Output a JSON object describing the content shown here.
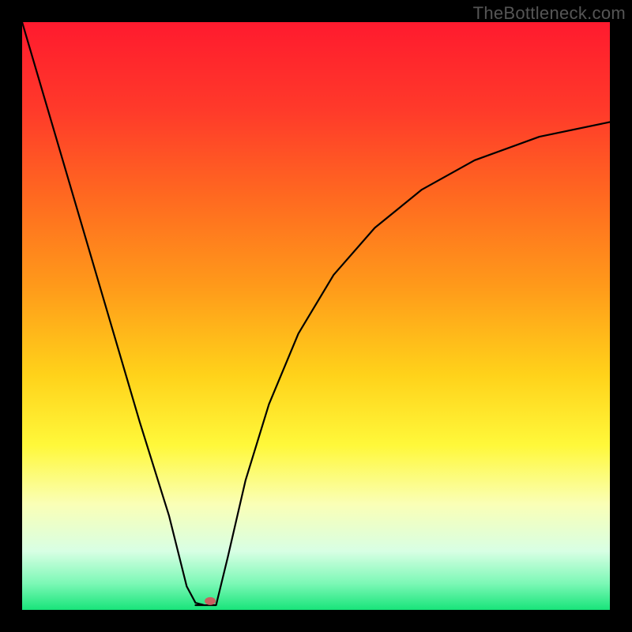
{
  "watermark": "TheBottleneck.com",
  "chart_data": {
    "type": "line",
    "title": "",
    "xlabel": "",
    "ylabel": "",
    "xlim": [
      0,
      100
    ],
    "ylim": [
      0,
      100
    ],
    "dip_x": 31,
    "dip_y": 0,
    "marker": {
      "x": 32,
      "y": 1.5,
      "color": "#c86060"
    },
    "series": [
      {
        "name": "curve",
        "segment": "left",
        "x": [
          0,
          5,
          10,
          15,
          20,
          25,
          28,
          29.5,
          31
        ],
        "y": [
          100,
          83,
          66,
          49,
          32,
          16,
          4,
          1.2,
          0.8
        ]
      },
      {
        "name": "curve",
        "segment": "flat",
        "x": [
          29.5,
          33
        ],
        "y": [
          0.8,
          0.8
        ]
      },
      {
        "name": "curve",
        "segment": "right",
        "x": [
          33,
          35,
          38,
          42,
          47,
          53,
          60,
          68,
          77,
          88,
          100
        ],
        "y": [
          0.8,
          9,
          22,
          35,
          47,
          57,
          65,
          71.5,
          76.5,
          80.5,
          83
        ]
      }
    ],
    "gradient_stops": [
      {
        "offset": 0.0,
        "color": "#ff1a2e"
      },
      {
        "offset": 0.15,
        "color": "#ff3a2a"
      },
      {
        "offset": 0.3,
        "color": "#ff6a20"
      },
      {
        "offset": 0.45,
        "color": "#ff9a1a"
      },
      {
        "offset": 0.6,
        "color": "#ffd21a"
      },
      {
        "offset": 0.72,
        "color": "#fff83a"
      },
      {
        "offset": 0.82,
        "color": "#faffb6"
      },
      {
        "offset": 0.9,
        "color": "#d8ffe4"
      },
      {
        "offset": 0.955,
        "color": "#7cf8b6"
      },
      {
        "offset": 1.0,
        "color": "#18e47a"
      }
    ]
  }
}
